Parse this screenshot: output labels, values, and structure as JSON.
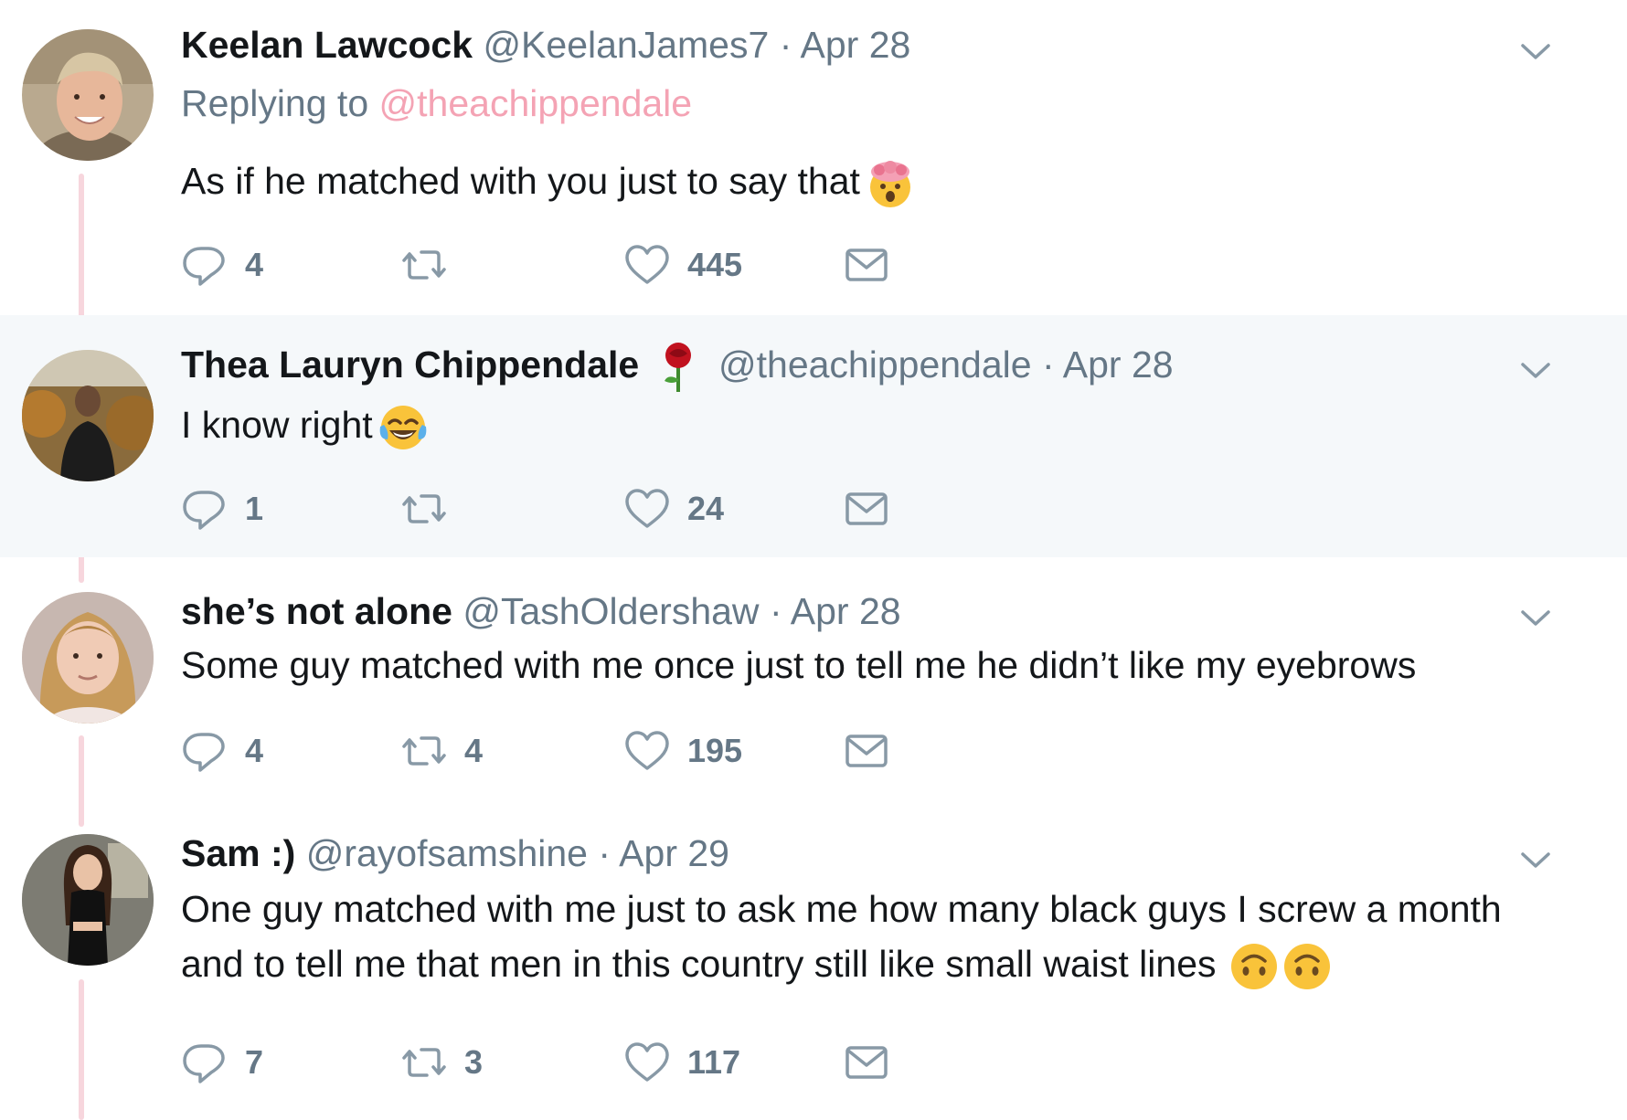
{
  "tweets": [
    {
      "name": "Keelan Lawcock",
      "handle": "@KeelanJames7",
      "separator": "·",
      "date": "Apr 28",
      "replying_label": "Replying to",
      "replying_to": "@theachippendale",
      "text": "As if he matched with you just to say that",
      "emoji": [
        "exploding-head-emoji"
      ],
      "replies": "4",
      "retweets": "",
      "likes": "445"
    },
    {
      "name": "Thea Lauryn Chippendale",
      "name_emoji": "rose-emoji",
      "handle": "@theachippendale",
      "separator": "·",
      "date": "Apr 28",
      "text": "I know right",
      "emoji": [
        "tears-of-joy-emoji"
      ],
      "replies": "1",
      "retweets": "",
      "likes": "24",
      "highlighted": true
    },
    {
      "name": "she’s not alone",
      "handle": "@TashOldershaw",
      "separator": "·",
      "date": "Apr 28",
      "text": "Some guy matched with me once just to tell me he didn’t like my eyebrows",
      "replies": "4",
      "retweets": "4",
      "likes": "195"
    },
    {
      "name": "Sam :)",
      "handle": "@rayofsamshine",
      "separator": "·",
      "date": "Apr 29",
      "text_line1": "One guy matched with me just to ask me how many black guys I screw a month",
      "text_line2": "and to tell me that men in this country still like small waist lines",
      "emoji": [
        "upside-down-face-emoji",
        "upside-down-face-emoji"
      ],
      "replies": "7",
      "retweets": "3",
      "likes": "117"
    }
  ],
  "colors": {
    "highlight_bg": "#f5f8fa",
    "secondary_text": "#657786",
    "mention": "#f4a3b4",
    "thread_line": "#f7d6dd"
  }
}
